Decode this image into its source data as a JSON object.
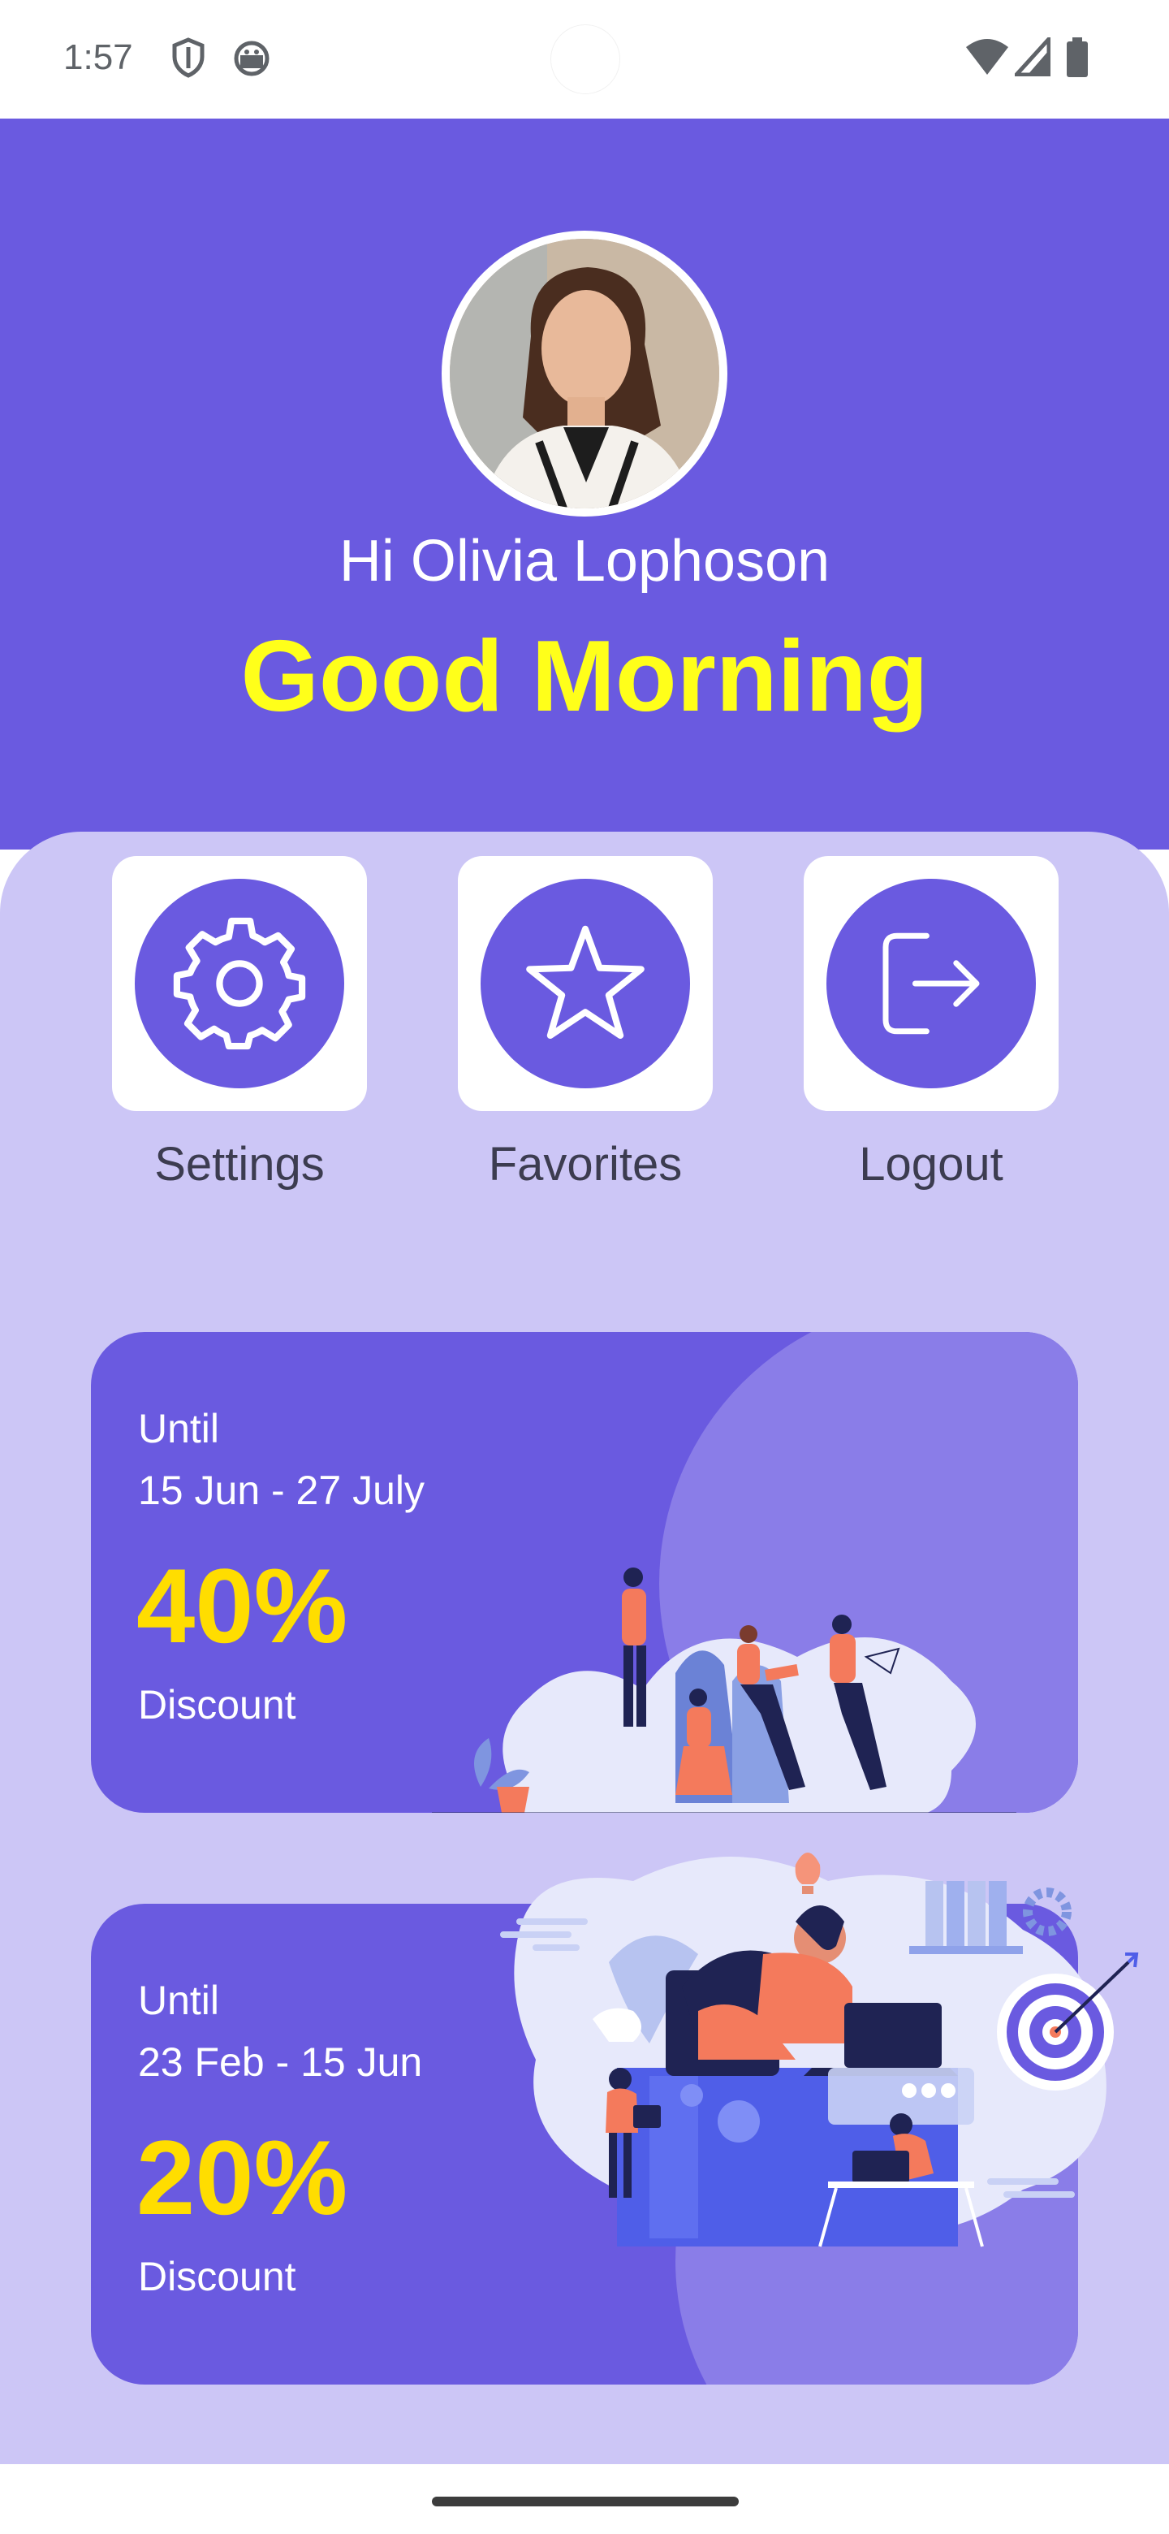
{
  "status_bar": {
    "time": "1:57",
    "icons": [
      "shield-icon",
      "android-icon",
      "wifi-icon",
      "signal-icon",
      "battery-icon"
    ]
  },
  "profile": {
    "greeting": "Hi Olivia Lophoson",
    "headline": "Good Morning"
  },
  "actions": [
    {
      "label": "Settings",
      "icon": "gear-icon"
    },
    {
      "label": "Favorites",
      "icon": "star-icon"
    },
    {
      "label": "Logout",
      "icon": "logout-icon"
    }
  ],
  "promos": [
    {
      "until": "Until",
      "dates": "15 Jun - 27 July",
      "percent": "40%",
      "label": "Discount"
    },
    {
      "until": "Until",
      "dates": "23 Feb - 15 Jun",
      "percent": "20%",
      "label": "Discount"
    }
  ],
  "colors": {
    "primary": "#6a5ae0",
    "panel": "#ccc6f6",
    "headline": "#ffff1a",
    "percent": "#ffdd00",
    "accent_orange": "#f47a5c"
  }
}
